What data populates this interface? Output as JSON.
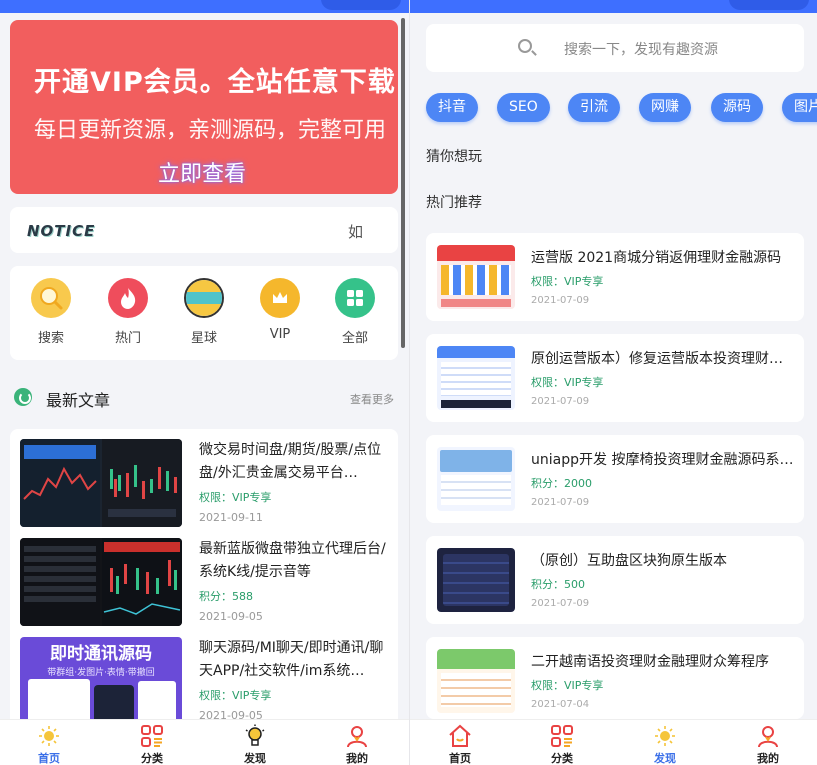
{
  "left": {
    "banner": {
      "line1": "开通VIP会员。全站任意下载",
      "line2": "每日更新资源，亲测源码，完整可用",
      "cta": "立即查看"
    },
    "notice": {
      "logo": "NOTICE",
      "text": "如"
    },
    "grid": [
      {
        "label": "搜索",
        "icon": "search-icon",
        "color": "#f8c94d"
      },
      {
        "label": "热门",
        "icon": "fire-icon",
        "color": "#ef4d5c"
      },
      {
        "label": "星球",
        "icon": "planet-icon",
        "color": "#f6c742"
      },
      {
        "label": "VIP",
        "icon": "crown-icon",
        "color": "#f5b72c"
      },
      {
        "label": "全部",
        "icon": "grid-icon",
        "color": "#35c28a"
      }
    ],
    "section": {
      "title": "最新文章",
      "more": "查看更多"
    },
    "articles": [
      {
        "title": "微交易时间盘/期货/股票/点位盘/外汇贵金属交易平台…",
        "meta": "权限：VIP专享",
        "date": "2021-09-11"
      },
      {
        "title": "最新蓝版微盘带独立代理后台/系统K线/提示音等",
        "meta": "积分：588",
        "date": "2021-09-05"
      },
      {
        "title": "聊天源码/MI聊天/即时通讯/聊天APP/社交软件/im系统…",
        "meta": "权限：VIP专享",
        "date": "2021-09-05",
        "thumb_title": "即时通讯源码",
        "thumb_sub": "带群组·发图片·表情·带撤回"
      }
    ],
    "tabbar": [
      {
        "label": "首页",
        "icon": "sun-icon",
        "active": true
      },
      {
        "label": "分类",
        "icon": "category-icon",
        "active": false
      },
      {
        "label": "发现",
        "icon": "bulb-icon",
        "active": false
      },
      {
        "label": "我的",
        "icon": "user-icon",
        "active": false
      }
    ]
  },
  "right": {
    "search_placeholder": "搜索一下，发现有趣资源",
    "tags": [
      "抖音",
      "SEO",
      "引流",
      "网赚",
      "源码",
      "图片"
    ],
    "guess_heading": "猜你想玩",
    "hot_heading": "热门推荐",
    "items": [
      {
        "title": "运营版 2021商城分销返佣理财金融源码",
        "meta": "权限：VIP专享",
        "date": "2021-07-09"
      },
      {
        "title": "原创运营版本）修复运营版本投资理财金…",
        "meta": "权限：VIP专享",
        "date": "2021-07-09"
      },
      {
        "title": "uniapp开发 按摩椅投资理财金融源码系…",
        "meta": "积分：2000",
        "date": "2021-07-09"
      },
      {
        "title": "（原创）互助盘区块狗原生版本",
        "meta": "积分：500",
        "date": "2021-07-09"
      },
      {
        "title": "二开越南语投资理财金融理财众筹程序",
        "meta": "权限：VIP专享",
        "date": "2021-07-04"
      }
    ],
    "tabbar": [
      {
        "label": "首页",
        "icon": "home-icon",
        "active": false
      },
      {
        "label": "分类",
        "icon": "category-icon",
        "active": false
      },
      {
        "label": "发现",
        "icon": "sun-icon",
        "active": true
      },
      {
        "label": "我的",
        "icon": "user-icon",
        "active": false
      }
    ]
  },
  "colors": {
    "accent": "#3a6fe8",
    "banner": "#f25e5e",
    "meta_green": "#2a9d6a",
    "tag_blue": "#4d86f5"
  }
}
